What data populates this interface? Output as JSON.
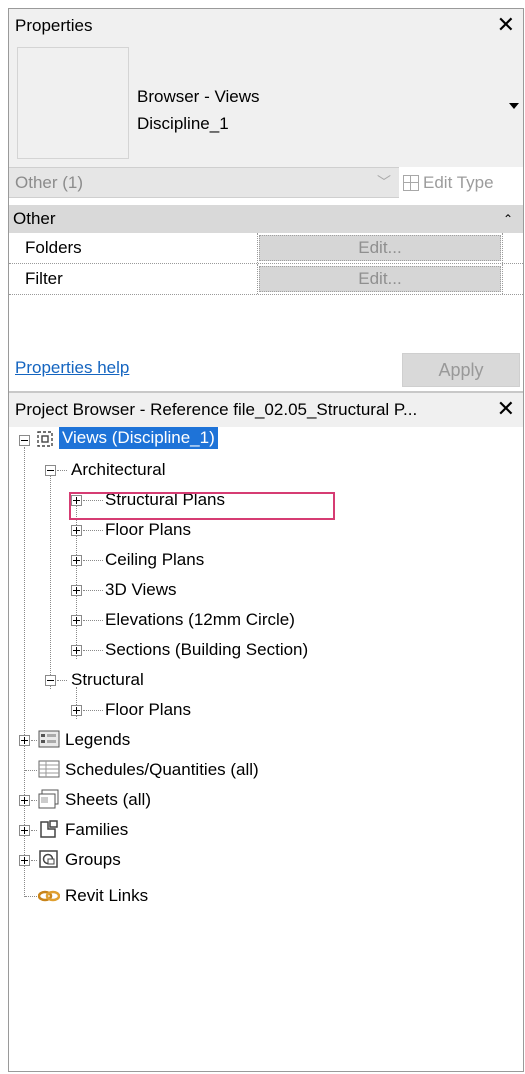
{
  "properties": {
    "title": "Properties",
    "type_name_line1": "Browser - Views",
    "type_name_line2": "Discipline_1",
    "selector": "Other (1)",
    "edit_type": "Edit Type",
    "group_label": "Other",
    "params": [
      {
        "label": "Folders",
        "value": "Edit..."
      },
      {
        "label": "Filter",
        "value": "Edit..."
      }
    ],
    "help_link": "Properties help",
    "apply": "Apply",
    "close": "✕"
  },
  "browser": {
    "title": "Project Browser - Reference file_02.05_Structural P...",
    "close": "✕",
    "root": "Views (Discipline_1)",
    "architectural": "Architectural",
    "arch_items": [
      "Structural Plans",
      "Floor Plans",
      "Ceiling Plans",
      "3D Views",
      "Elevations (12mm Circle)",
      "Sections (Building Section)"
    ],
    "structural": "Structural",
    "struct_items": [
      "Floor Plans"
    ],
    "top_items": [
      {
        "label": "Legends",
        "icon": "legends-icon"
      },
      {
        "label": "Schedules/Quantities (all)",
        "icon": "schedules-icon"
      },
      {
        "label": "Sheets (all)",
        "icon": "sheets-icon"
      },
      {
        "label": "Families",
        "icon": "families-icon"
      },
      {
        "label": "Groups",
        "icon": "groups-icon"
      },
      {
        "label": "Revit Links",
        "icon": "revit-links-icon"
      }
    ]
  },
  "colors": {
    "selection": "#1e73d8",
    "highlight_box": "#d63c73",
    "link": "#1565c0"
  }
}
